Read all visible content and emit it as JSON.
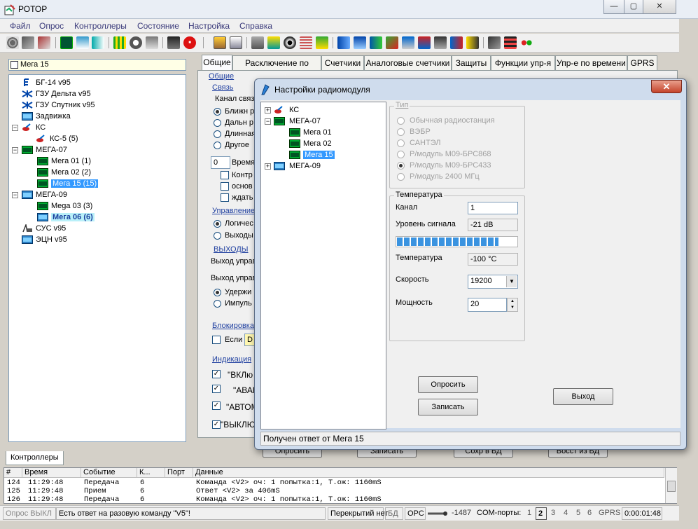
{
  "app": {
    "title": "РОТОР",
    "minimize": "—",
    "maximize": "▢",
    "close": "✕"
  },
  "menu": [
    "Файл",
    "Опрос",
    "Контроллеры",
    "Состояние",
    "Настройка",
    "Справка"
  ],
  "left": {
    "search_value": "Мега 15",
    "tree": [
      {
        "label": "БГ-14 v95",
        "icon": "mast-icon"
      },
      {
        "label": "ГЗУ Дельта v95",
        "icon": "valve-icon"
      },
      {
        "label": "ГЗУ Спутник v95",
        "icon": "valve-icon"
      },
      {
        "label": "Задвижка",
        "icon": "mega-icon"
      },
      {
        "label": "КС",
        "icon": "compressor-icon"
      },
      {
        "label": "КС-5 (5)",
        "icon": "compressor-icon"
      },
      {
        "label": "МЕГА-07",
        "icon": "mega-icon"
      },
      {
        "label": "Мега 01 (1)",
        "icon": "mega-icon"
      },
      {
        "label": "Мега 02 (2)",
        "icon": "mega-icon"
      },
      {
        "label": "Мега 15 (15)",
        "icon": "mega-icon"
      },
      {
        "label": "МЕГА-09",
        "icon": "mega-icon"
      },
      {
        "label": "Mega 03 (3)",
        "icon": "mega-icon"
      },
      {
        "label": "Мега 06 (6)",
        "icon": "mega-icon"
      },
      {
        "label": "СУС v95",
        "icon": "pump-icon"
      },
      {
        "label": "ЭЦН v95",
        "icon": "mega-icon"
      }
    ],
    "bottom_tab": "Контроллеры"
  },
  "tabs": [
    "Общие",
    "Расключение по месту",
    "Счетчики",
    "Аналоговые счетчики",
    "Защиты",
    "Функции упр-я",
    "Упр-е по времени",
    "GPRS"
  ],
  "panel": {
    "general_label": "Общие",
    "link_label": "Связь",
    "channel_label": "Канал связ",
    "channel_options": [
      "Ближн р",
      "Дальн р",
      "Длинная",
      "Другое"
    ],
    "time_value": "0",
    "time_label": "Время",
    "checks": [
      "Контр",
      "основ",
      "ждать"
    ],
    "control_label": "Управление",
    "control_options": [
      "Логичес",
      "Выходы"
    ],
    "outputs_label": "ВЫХОДЫ",
    "output_ctrl_1": "Выход управ",
    "output_ctrl_2": "Выход управ",
    "hold_options": [
      "Удержи",
      "Импуль"
    ],
    "block_label": "Блокировка",
    "block_if": "Если",
    "block_d": "D",
    "indication_label": "Индикация",
    "indication_items": [
      "\"ВКЛю",
      "\"АВАР",
      "\"АВТОМ",
      "\"ВЫКЛЮ"
    ],
    "hidden_buttons": [
      "Опросить",
      "Записать",
      "Сохр в БД",
      "Восст из БД"
    ]
  },
  "dialog": {
    "title": "Настройки радиомодуля",
    "close": "✕",
    "tree": [
      "КС",
      "МЕГА-07",
      "Мега 01",
      "Мега 02",
      "Мега 15",
      "МЕГА-09"
    ],
    "type_label": "Тип",
    "type_options": [
      "Обычная радиостанция",
      "ВЭБР",
      "САНТЭЛ",
      "Р/модуль М09-БРС868",
      "Р/модуль М09-БРС433",
      "Р/модуль 2400 МГц"
    ],
    "temp_group": "Температура",
    "channel_label": "Канал",
    "channel_value": "1",
    "signal_label": "Уровень сигнала",
    "signal_value": "-21 dB",
    "signal_level_fraction": 0.85,
    "temperature_label": "Температура",
    "temperature_value": "-100 °С",
    "speed_label": "Скорость",
    "speed_value": "19200",
    "power_label": "Мощность",
    "power_value": "20",
    "poll_button": "Опросить",
    "write_button": "Записать",
    "exit_button": "Выход",
    "status": "Получен ответ от Мега 15"
  },
  "log": {
    "headers": [
      "#",
      "Время",
      "Событие",
      "К...",
      "Порт",
      "Данные"
    ],
    "rows": [
      {
        "n": "124",
        "time": "11:29:48",
        "event": "Передача",
        "k": "6",
        "port": "",
        "data": "Команда <V2> оч: 1 попытка:1, Т.ож: 1160mS"
      },
      {
        "n": "125",
        "time": "11:29:48",
        "event": "Прием",
        "k": "6",
        "port": "",
        "data": "Ответ <V2> за 406mS"
      },
      {
        "n": "126",
        "time": "11:29:48",
        "event": "Передача",
        "k": "6",
        "port": "",
        "data": "Команда <V2> оч: 1 попытка:1, Т.ож: 1160mS"
      }
    ]
  },
  "status": {
    "poll": "Опрос ВЫКЛ",
    "message": "Есть ответ на разовую команду \"V5\"!",
    "overlap": "Перекрытий нет",
    "db": "БД",
    "opc": "OPC",
    "level": "-1487",
    "com_label": "COM-порты:",
    "ports": [
      "1",
      "2",
      "3",
      "4",
      "5",
      "6"
    ],
    "gprs": "GPRS",
    "timer": "0:00:01:48"
  }
}
